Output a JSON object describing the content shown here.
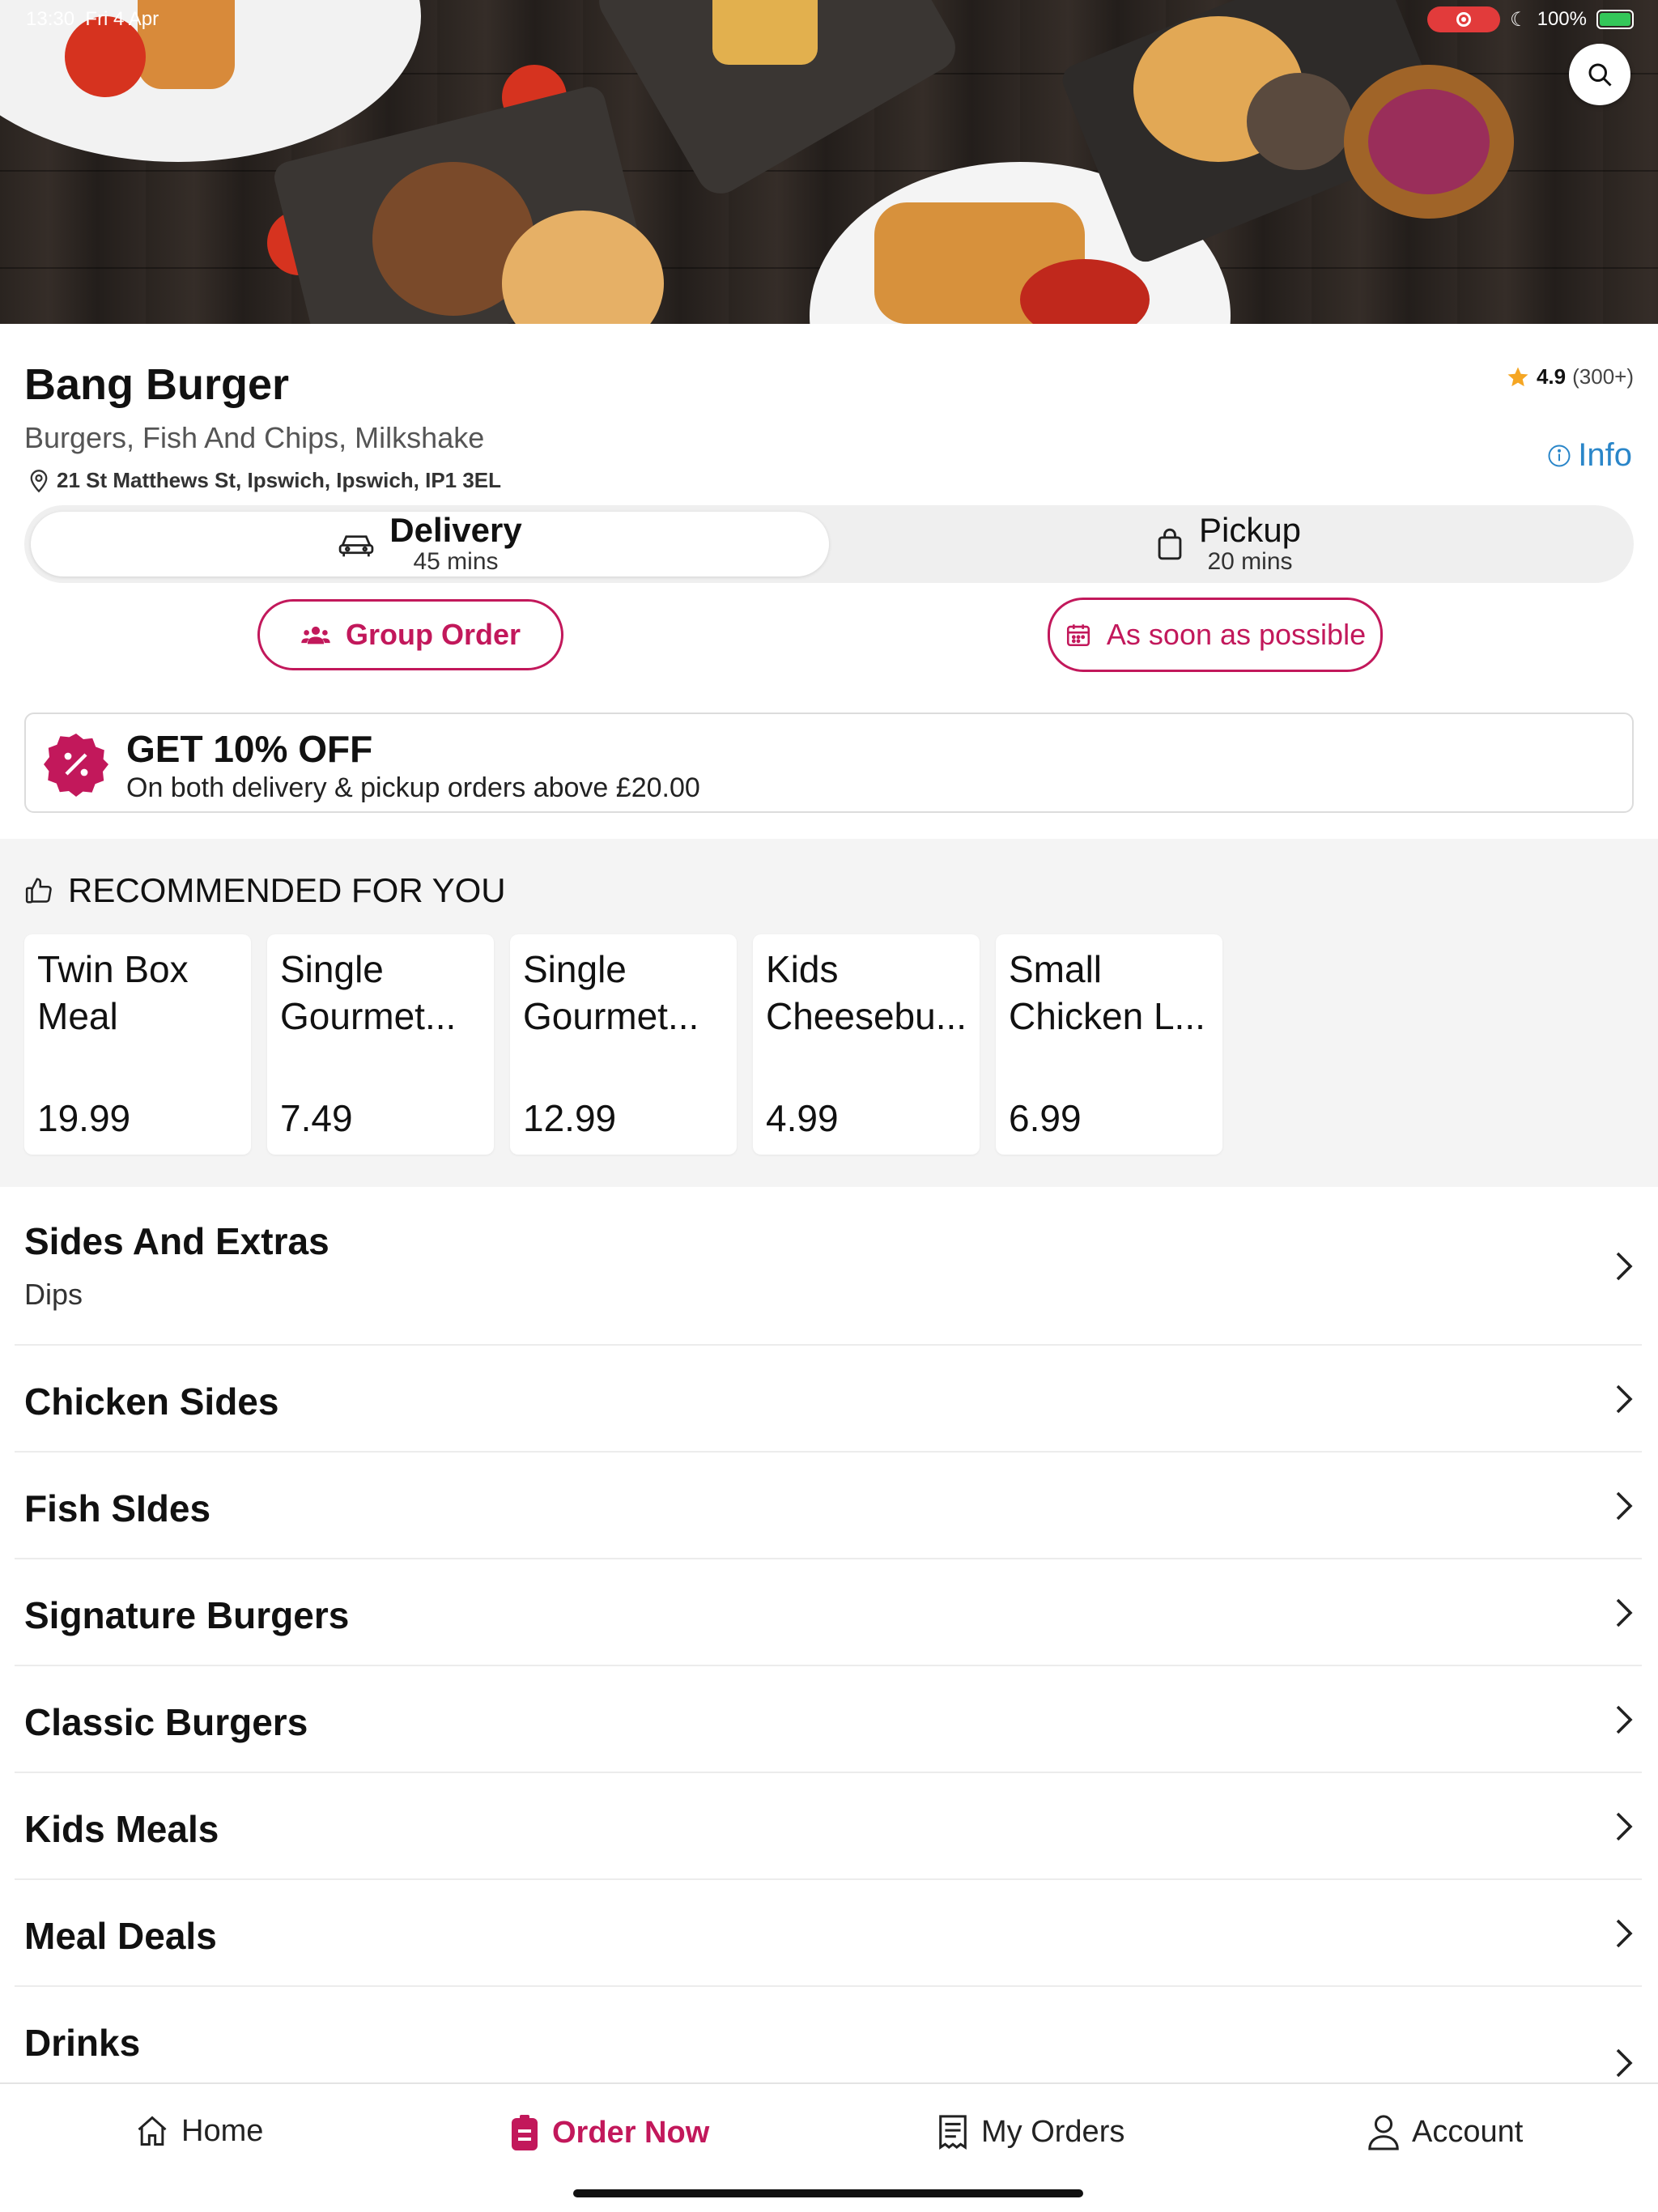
{
  "status_bar": {
    "time": "13:30",
    "date": "Fri 4 Apr",
    "battery": "100%"
  },
  "restaurant": {
    "name": "Bang Burger",
    "cuisines": "Burgers, Fish And Chips, Milkshake",
    "address": "21 St Matthews St, Ipswich, Ipswich, IP1 3EL",
    "rating": "4.9",
    "rating_count": "(300+)",
    "info_label": "Info"
  },
  "fulfilment": {
    "delivery_label": "Delivery",
    "delivery_time": "45 mins",
    "pickup_label": "Pickup",
    "pickup_time": "20 mins",
    "selected": "Delivery"
  },
  "actions": {
    "group_order": "Group Order",
    "schedule": "As soon as possible"
  },
  "promo": {
    "title": "GET 10% OFF",
    "subtitle": "On both delivery & pickup orders above £20.00"
  },
  "recommended": {
    "heading": "RECOMMENDED FOR YOU",
    "items": [
      {
        "name": "Twin Box Meal",
        "price": "19.99"
      },
      {
        "name": "Single Gourmet...",
        "price": "7.49"
      },
      {
        "name": "Single Gourmet...",
        "price": "12.99"
      },
      {
        "name": "Kids Cheesebu...",
        "price": "4.99"
      },
      {
        "name": "Small Chicken L...",
        "price": "6.99"
      }
    ]
  },
  "categories": [
    {
      "name": "Sides And Extras",
      "subtitle": "Dips"
    },
    {
      "name": "Chicken Sides"
    },
    {
      "name": "Fish SIdes"
    },
    {
      "name": "Signature Burgers"
    },
    {
      "name": "Classic Burgers"
    },
    {
      "name": "Kids Meals"
    },
    {
      "name": "Meal Deals"
    },
    {
      "name": "Drinks"
    }
  ],
  "tabs": [
    {
      "label": "Home",
      "icon": "home-icon"
    },
    {
      "label": "Order Now",
      "icon": "order-icon"
    },
    {
      "label": "My Orders",
      "icon": "receipt-icon"
    },
    {
      "label": "Account",
      "icon": "person-icon"
    }
  ],
  "colors": {
    "accent": "#c2185b",
    "link": "#2a86c9",
    "star": "#f5a623"
  }
}
